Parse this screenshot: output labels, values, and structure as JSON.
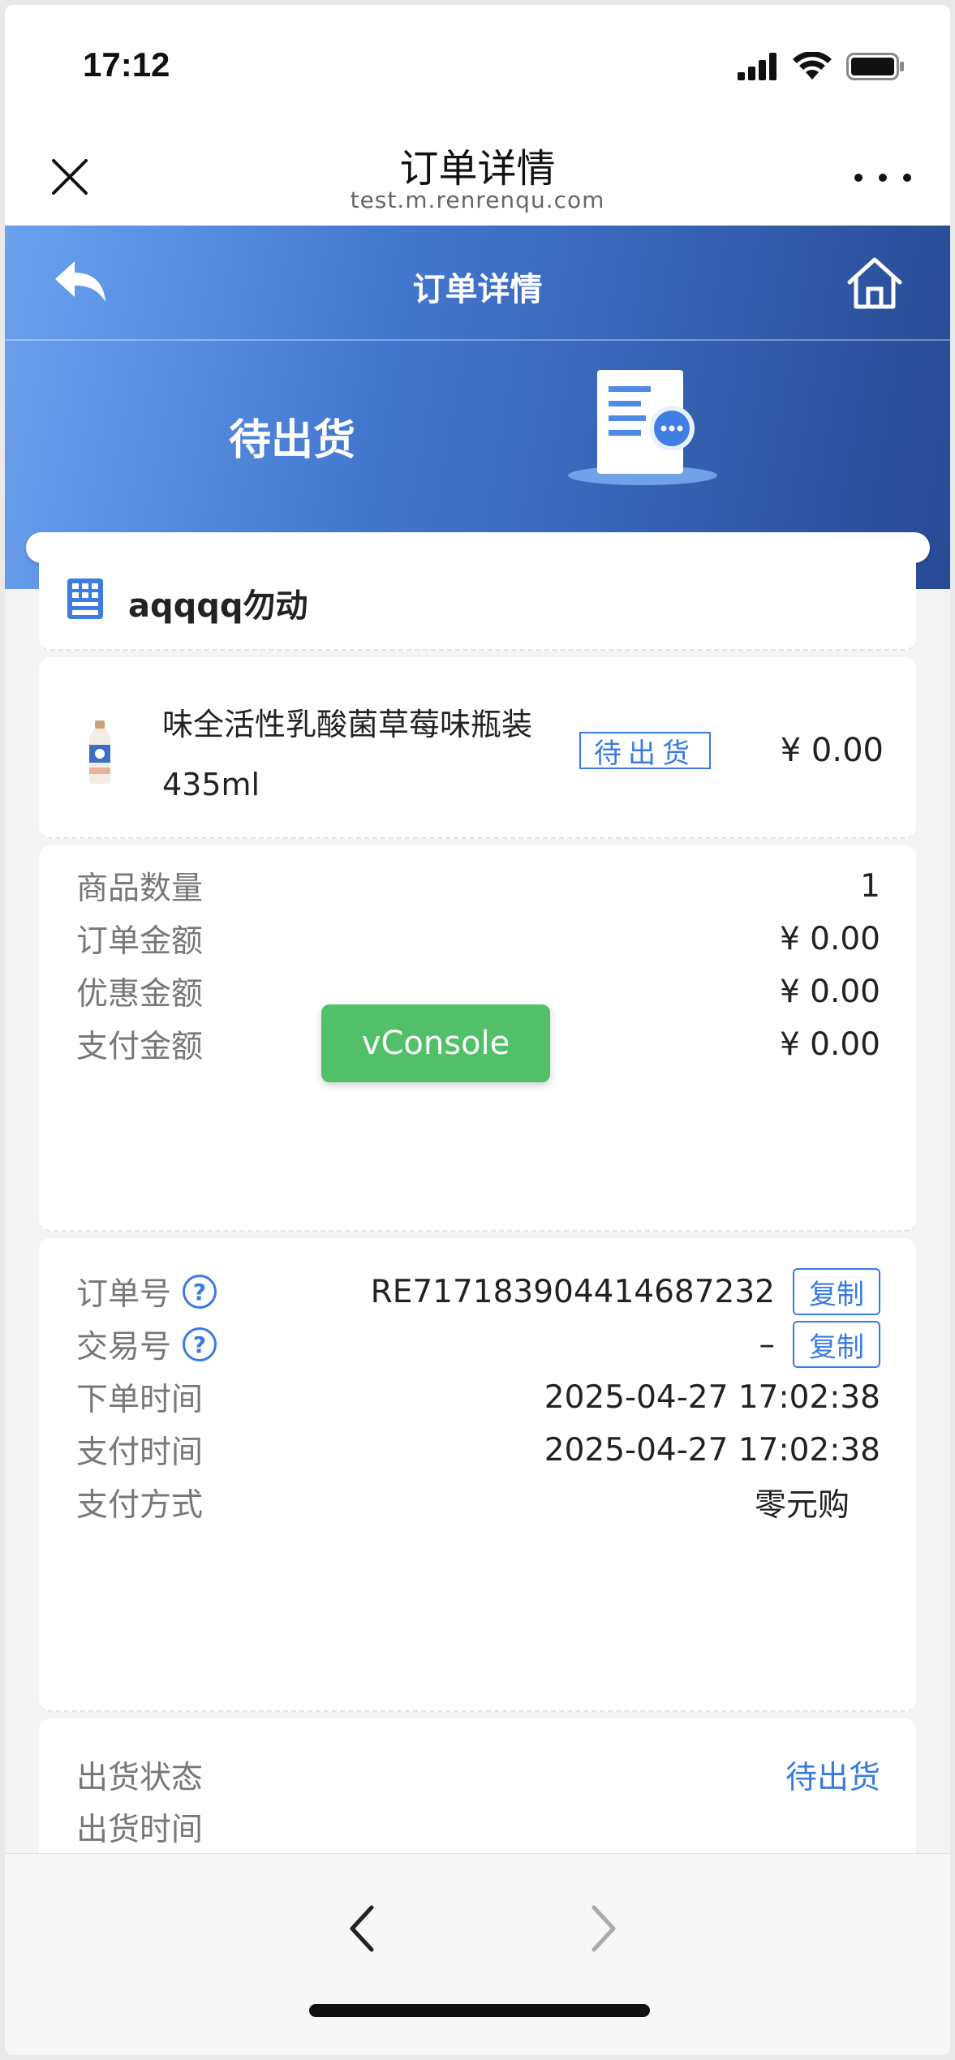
{
  "status_bar": {
    "time": "17:12"
  },
  "title_bar": {
    "title": "订单详情",
    "domain": "test.m.renrenqu.com"
  },
  "header": {
    "title": "订单详情",
    "order_status": "待出货"
  },
  "shop": {
    "name": "aqqqq勿动"
  },
  "product": {
    "name": "味全活性乳酸菌草莓味瓶装435ml",
    "badge": "待出货",
    "price": "¥ 0.00"
  },
  "amounts": [
    {
      "label": "商品数量",
      "value": "1"
    },
    {
      "label": "订单金额",
      "value": "¥ 0.00"
    },
    {
      "label": "优惠金额",
      "value": "¥ 0.00"
    },
    {
      "label": "支付金额",
      "value": "¥ 0.00"
    }
  ],
  "order_info": {
    "order_no_label": "订单号",
    "order_no": "RE717183904414687232",
    "trade_no_label": "交易号",
    "trade_no": "–",
    "copy_label": "复制",
    "order_time_label": "下单时间",
    "order_time": "2025-04-27 17:02:38",
    "pay_time_label": "支付时间",
    "pay_time": "2025-04-27 17:02:38",
    "pay_method_label": "支付方式",
    "pay_method": "零元购"
  },
  "shipping": {
    "status_label": "出货状态",
    "status_value": "待出货",
    "time_label": "出货时间"
  },
  "vconsole": {
    "label": "vConsole"
  },
  "colors": {
    "accent": "#3a7be0",
    "header_start": "#6aa1ee",
    "header_end": "#274a94",
    "vconsole": "#52bf69"
  }
}
